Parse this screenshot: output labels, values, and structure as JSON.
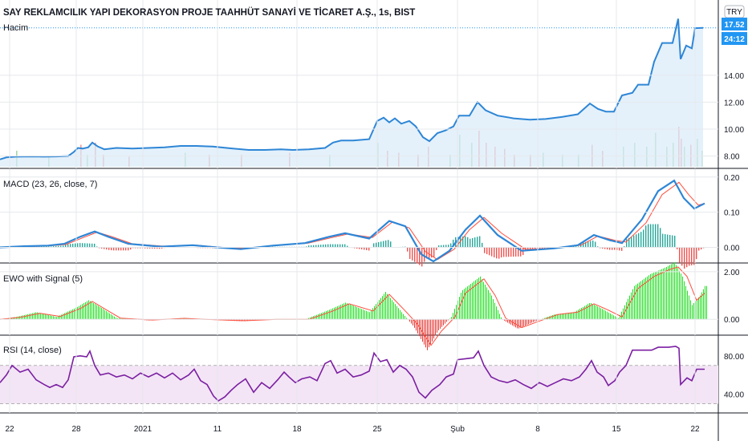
{
  "chart_data": {
    "type": "line",
    "title": "SAY REKLAMCILIK YAPI DEKORASYON PROJE TAAHHÜT SANAYİ VE TİCARET A.Ş., 1s, BIST",
    "currency_badge": "TRY",
    "price_label": "17.52",
    "countdown_label": "24:12",
    "volume_label": "Hacim",
    "x_tick_labels": [
      "22",
      "28",
      "2021",
      "11",
      "18",
      "25",
      "Şub",
      "8",
      "15",
      "22"
    ],
    "price_axis": {
      "ylim": [
        7.2,
        18.4
      ],
      "ticks": [
        "8.00",
        "10.00",
        "12.00",
        "14.00"
      ]
    },
    "price_series": [
      [
        0,
        7.75
      ],
      [
        8,
        7.9
      ],
      [
        20,
        7.95
      ],
      [
        40,
        7.97
      ],
      [
        55,
        7.95
      ],
      [
        70,
        7.97
      ],
      [
        85,
        8.0
      ],
      [
        92,
        8.3
      ],
      [
        97,
        8.6
      ],
      [
        103,
        8.55
      ],
      [
        110,
        8.65
      ],
      [
        115,
        9.0
      ],
      [
        122,
        8.7
      ],
      [
        130,
        8.5
      ],
      [
        145,
        8.6
      ],
      [
        165,
        8.55
      ],
      [
        185,
        8.6
      ],
      [
        205,
        8.65
      ],
      [
        225,
        8.75
      ],
      [
        245,
        8.75
      ],
      [
        265,
        8.7
      ],
      [
        290,
        8.55
      ],
      [
        310,
        8.45
      ],
      [
        330,
        8.45
      ],
      [
        350,
        8.5
      ],
      [
        365,
        8.45
      ],
      [
        385,
        8.5
      ],
      [
        405,
        8.6
      ],
      [
        415,
        9.0
      ],
      [
        425,
        9.15
      ],
      [
        440,
        9.15
      ],
      [
        460,
        9.25
      ],
      [
        470,
        10.6
      ],
      [
        478,
        10.85
      ],
      [
        485,
        10.5
      ],
      [
        492,
        10.8
      ],
      [
        500,
        10.4
      ],
      [
        510,
        10.6
      ],
      [
        518,
        10.2
      ],
      [
        527,
        9.4
      ],
      [
        535,
        9.1
      ],
      [
        545,
        9.7
      ],
      [
        555,
        9.9
      ],
      [
        565,
        10.2
      ],
      [
        572,
        11.0
      ],
      [
        585,
        11.0
      ],
      [
        595,
        12.0
      ],
      [
        605,
        11.4
      ],
      [
        620,
        11.0
      ],
      [
        640,
        10.8
      ],
      [
        660,
        10.7
      ],
      [
        680,
        10.75
      ],
      [
        700,
        10.9
      ],
      [
        720,
        11.1
      ],
      [
        735,
        11.9
      ],
      [
        745,
        11.5
      ],
      [
        755,
        11.3
      ],
      [
        765,
        11.3
      ],
      [
        775,
        12.5
      ],
      [
        788,
        12.7
      ],
      [
        795,
        13.3
      ],
      [
        808,
        13.3
      ],
      [
        815,
        15.0
      ],
      [
        825,
        16.4
      ],
      [
        838,
        16.4
      ],
      [
        845,
        18.2
      ],
      [
        848,
        15.2
      ],
      [
        855,
        16.2
      ],
      [
        862,
        16.0
      ],
      [
        866,
        17.5
      ],
      [
        876,
        17.52
      ]
    ],
    "macd_axis": {
      "ylim": [
        -0.04,
        0.22
      ],
      "ticks": [
        "0.20",
        "0.10",
        "0.00"
      ]
    },
    "macd_label": "MACD (23, 26, close, 7)",
    "macd_series": [
      [
        0,
        0.0
      ],
      [
        30,
        0.003
      ],
      [
        60,
        0.005
      ],
      [
        80,
        0.01
      ],
      [
        100,
        0.03
      ],
      [
        118,
        0.045
      ],
      [
        135,
        0.03
      ],
      [
        160,
        0.01
      ],
      [
        200,
        0.002
      ],
      [
        240,
        0.006
      ],
      [
        270,
        0.0
      ],
      [
        300,
        -0.005
      ],
      [
        340,
        0.005
      ],
      [
        380,
        0.012
      ],
      [
        410,
        0.03
      ],
      [
        430,
        0.04
      ],
      [
        460,
        0.025
      ],
      [
        485,
        0.075
      ],
      [
        505,
        0.06
      ],
      [
        525,
        -0.02
      ],
      [
        540,
        -0.04
      ],
      [
        560,
        -0.01
      ],
      [
        580,
        0.05
      ],
      [
        598,
        0.09
      ],
      [
        620,
        0.035
      ],
      [
        650,
        -0.01
      ],
      [
        690,
        -0.003
      ],
      [
        720,
        0.006
      ],
      [
        740,
        0.035
      ],
      [
        760,
        0.02
      ],
      [
        775,
        0.012
      ],
      [
        800,
        0.08
      ],
      [
        820,
        0.16
      ],
      [
        840,
        0.19
      ],
      [
        852,
        0.14
      ],
      [
        865,
        0.11
      ],
      [
        878,
        0.125
      ]
    ],
    "macd_signal": [
      [
        0,
        0.0
      ],
      [
        30,
        0.002
      ],
      [
        60,
        0.004
      ],
      [
        82,
        0.008
      ],
      [
        104,
        0.028
      ],
      [
        121,
        0.043
      ],
      [
        140,
        0.03
      ],
      [
        165,
        0.01
      ],
      [
        205,
        0.003
      ],
      [
        244,
        0.006
      ],
      [
        275,
        0.0
      ],
      [
        305,
        -0.003
      ],
      [
        344,
        0.005
      ],
      [
        384,
        0.012
      ],
      [
        414,
        0.028
      ],
      [
        434,
        0.038
      ],
      [
        464,
        0.028
      ],
      [
        489,
        0.072
      ],
      [
        510,
        0.055
      ],
      [
        530,
        -0.012
      ],
      [
        545,
        -0.035
      ],
      [
        566,
        -0.005
      ],
      [
        585,
        0.05
      ],
      [
        603,
        0.085
      ],
      [
        625,
        0.04
      ],
      [
        655,
        -0.006
      ],
      [
        695,
        -0.002
      ],
      [
        724,
        0.006
      ],
      [
        745,
        0.032
      ],
      [
        766,
        0.02
      ],
      [
        780,
        0.015
      ],
      [
        805,
        0.07
      ],
      [
        825,
        0.15
      ],
      [
        846,
        0.185
      ],
      [
        858,
        0.15
      ],
      [
        870,
        0.12
      ],
      [
        878,
        0.125
      ]
    ],
    "ewo_axis": {
      "ylim": [
        -0.6,
        2.3
      ],
      "ticks": [
        "2.00",
        "0.00"
      ]
    },
    "ewo_label": "EWO with Signal (5)",
    "ewo_series": [
      [
        0,
        0.0
      ],
      [
        20,
        0.1
      ],
      [
        45,
        0.3
      ],
      [
        70,
        0.1
      ],
      [
        95,
        0.5
      ],
      [
        110,
        0.8
      ],
      [
        125,
        0.5
      ],
      [
        145,
        0.05
      ],
      [
        185,
        -0.05
      ],
      [
        225,
        0.05
      ],
      [
        250,
        0.0
      ],
      [
        300,
        -0.08
      ],
      [
        340,
        0.0
      ],
      [
        380,
        0.0
      ],
      [
        410,
        0.4
      ],
      [
        430,
        0.7
      ],
      [
        460,
        0.3
      ],
      [
        480,
        1.15
      ],
      [
        500,
        0.3
      ],
      [
        515,
        -0.3
      ],
      [
        532,
        -1.3
      ],
      [
        545,
        -0.5
      ],
      [
        562,
        0.1
      ],
      [
        575,
        1.2
      ],
      [
        598,
        1.8
      ],
      [
        612,
        1.0
      ],
      [
        625,
        0.0
      ],
      [
        645,
        -0.4
      ],
      [
        665,
        -0.1
      ],
      [
        690,
        0.2
      ],
      [
        715,
        0.3
      ],
      [
        735,
        0.7
      ],
      [
        752,
        0.4
      ],
      [
        770,
        0.05
      ],
      [
        790,
        1.4
      ],
      [
        810,
        1.9
      ],
      [
        830,
        2.2
      ],
      [
        840,
        2.4
      ],
      [
        850,
        1.8
      ],
      [
        862,
        0.6
      ],
      [
        872,
        1.0
      ],
      [
        878,
        1.4
      ]
    ],
    "ewo_signal": [
      [
        0,
        0.0
      ],
      [
        25,
        0.08
      ],
      [
        50,
        0.25
      ],
      [
        75,
        0.12
      ],
      [
        100,
        0.45
      ],
      [
        115,
        0.75
      ],
      [
        130,
        0.45
      ],
      [
        150,
        0.05
      ],
      [
        190,
        -0.03
      ],
      [
        230,
        0.04
      ],
      [
        255,
        0.0
      ],
      [
        305,
        -0.06
      ],
      [
        345,
        0.0
      ],
      [
        385,
        0.0
      ],
      [
        415,
        0.35
      ],
      [
        435,
        0.65
      ],
      [
        465,
        0.35
      ],
      [
        485,
        1.05
      ],
      [
        505,
        0.35
      ],
      [
        520,
        -0.2
      ],
      [
        537,
        -1.1
      ],
      [
        550,
        -0.5
      ],
      [
        567,
        0.1
      ],
      [
        580,
        1.1
      ],
      [
        603,
        1.7
      ],
      [
        617,
        1.0
      ],
      [
        630,
        0.05
      ],
      [
        650,
        -0.35
      ],
      [
        670,
        -0.1
      ],
      [
        695,
        0.2
      ],
      [
        720,
        0.3
      ],
      [
        740,
        0.65
      ],
      [
        757,
        0.4
      ],
      [
        775,
        0.1
      ],
      [
        795,
        1.3
      ],
      [
        815,
        1.8
      ],
      [
        835,
        2.1
      ],
      [
        845,
        2.2
      ],
      [
        856,
        1.8
      ],
      [
        868,
        0.8
      ],
      [
        878,
        1.1
      ]
    ],
    "rsi_axis": {
      "ylim": [
        22,
        100
      ],
      "ticks": [
        "80.00",
        "40.00"
      ],
      "band": [
        30,
        70
      ]
    },
    "rsi_label": "RSI (14, close)",
    "rsi_series": [
      [
        0,
        52
      ],
      [
        8,
        60
      ],
      [
        15,
        70
      ],
      [
        25,
        63
      ],
      [
        35,
        66
      ],
      [
        45,
        55
      ],
      [
        55,
        50
      ],
      [
        62,
        47
      ],
      [
        70,
        50
      ],
      [
        78,
        47
      ],
      [
        85,
        55
      ],
      [
        92,
        79
      ],
      [
        100,
        80
      ],
      [
        108,
        79
      ],
      [
        112,
        85
      ],
      [
        118,
        70
      ],
      [
        125,
        60
      ],
      [
        135,
        62
      ],
      [
        145,
        58
      ],
      [
        155,
        60
      ],
      [
        165,
        56
      ],
      [
        175,
        62
      ],
      [
        185,
        58
      ],
      [
        195,
        62
      ],
      [
        205,
        57
      ],
      [
        215,
        62
      ],
      [
        225,
        55
      ],
      [
        235,
        60
      ],
      [
        242,
        66
      ],
      [
        250,
        54
      ],
      [
        258,
        50
      ],
      [
        266,
        38
      ],
      [
        272,
        33
      ],
      [
        280,
        37
      ],
      [
        288,
        44
      ],
      [
        296,
        50
      ],
      [
        306,
        56
      ],
      [
        316,
        42
      ],
      [
        326,
        52
      ],
      [
        336,
        46
      ],
      [
        346,
        55
      ],
      [
        354,
        63
      ],
      [
        360,
        58
      ],
      [
        368,
        52
      ],
      [
        376,
        56
      ],
      [
        386,
        58
      ],
      [
        395,
        54
      ],
      [
        405,
        72
      ],
      [
        412,
        75
      ],
      [
        420,
        62
      ],
      [
        430,
        66
      ],
      [
        440,
        58
      ],
      [
        450,
        60
      ],
      [
        460,
        64
      ],
      [
        466,
        83
      ],
      [
        474,
        74
      ],
      [
        482,
        76
      ],
      [
        490,
        63
      ],
      [
        498,
        70
      ],
      [
        506,
        66
      ],
      [
        514,
        58
      ],
      [
        522,
        42
      ],
      [
        530,
        36
      ],
      [
        538,
        44
      ],
      [
        548,
        50
      ],
      [
        556,
        58
      ],
      [
        565,
        61
      ],
      [
        570,
        76
      ],
      [
        580,
        77
      ],
      [
        590,
        78
      ],
      [
        596,
        85
      ],
      [
        603,
        70
      ],
      [
        612,
        58
      ],
      [
        622,
        54
      ],
      [
        632,
        52
      ],
      [
        642,
        55
      ],
      [
        652,
        50
      ],
      [
        662,
        46
      ],
      [
        672,
        52
      ],
      [
        682,
        48
      ],
      [
        692,
        52
      ],
      [
        702,
        56
      ],
      [
        712,
        54
      ],
      [
        722,
        58
      ],
      [
        730,
        66
      ],
      [
        737,
        75
      ],
      [
        744,
        63
      ],
      [
        752,
        58
      ],
      [
        758,
        49
      ],
      [
        766,
        54
      ],
      [
        772,
        63
      ],
      [
        780,
        70
      ],
      [
        788,
        86
      ],
      [
        800,
        86
      ],
      [
        812,
        86
      ],
      [
        820,
        89
      ],
      [
        833,
        89
      ],
      [
        842,
        90
      ],
      [
        846,
        88
      ],
      [
        848,
        50
      ],
      [
        856,
        57
      ],
      [
        862,
        54
      ],
      [
        868,
        66
      ],
      [
        878,
        66
      ]
    ],
    "volume_bars": [
      [
        20,
        0.4
      ],
      [
        60,
        0.25
      ],
      [
        100,
        0.55
      ],
      [
        108,
        0.3
      ],
      [
        118,
        0.6
      ],
      [
        128,
        0.3
      ],
      [
        160,
        0.25
      ],
      [
        230,
        0.35
      ],
      [
        260,
        0.3
      ],
      [
        300,
        0.3
      ],
      [
        360,
        0.35
      ],
      [
        410,
        0.3
      ],
      [
        470,
        0.6
      ],
      [
        482,
        0.4
      ],
      [
        496,
        0.35
      ],
      [
        520,
        0.3
      ],
      [
        533,
        0.5
      ],
      [
        560,
        0.3
      ],
      [
        572,
        0.8
      ],
      [
        587,
        0.6
      ],
      [
        596,
        0.9
      ],
      [
        605,
        0.6
      ],
      [
        616,
        0.5
      ],
      [
        628,
        0.45
      ],
      [
        640,
        0.3
      ],
      [
        660,
        0.3
      ],
      [
        676,
        0.35
      ],
      [
        700,
        0.3
      ],
      [
        720,
        0.3
      ],
      [
        737,
        0.55
      ],
      [
        750,
        0.4
      ],
      [
        776,
        0.5
      ],
      [
        790,
        0.6
      ],
      [
        805,
        0.5
      ],
      [
        816,
        0.85
      ],
      [
        830,
        0.5
      ],
      [
        838,
        0.6
      ],
      [
        845,
        1.0
      ],
      [
        848,
        0.7
      ],
      [
        852,
        0.5
      ],
      [
        860,
        0.55
      ],
      [
        868,
        0.7
      ],
      [
        874,
        0.4
      ]
    ],
    "colors": {
      "price_line": "#2e86d6",
      "price_fill": "#d9ebfa",
      "macd_line": "#2e86d6",
      "macd_signal": "#ff4d3d",
      "hist_up": "#26a69a",
      "hist_down": "#ef5350",
      "ewo_up": "#22dd22",
      "ewo_down": "#e53935",
      "ewo_signal": "#ff4d3d",
      "rsi_line": "#7b1fa2",
      "rsi_band": "#f3e5f5",
      "badge_bg": "#2196f3",
      "vol_up": "#a5d6a7",
      "vol_down": "#ef9a9a"
    }
  }
}
